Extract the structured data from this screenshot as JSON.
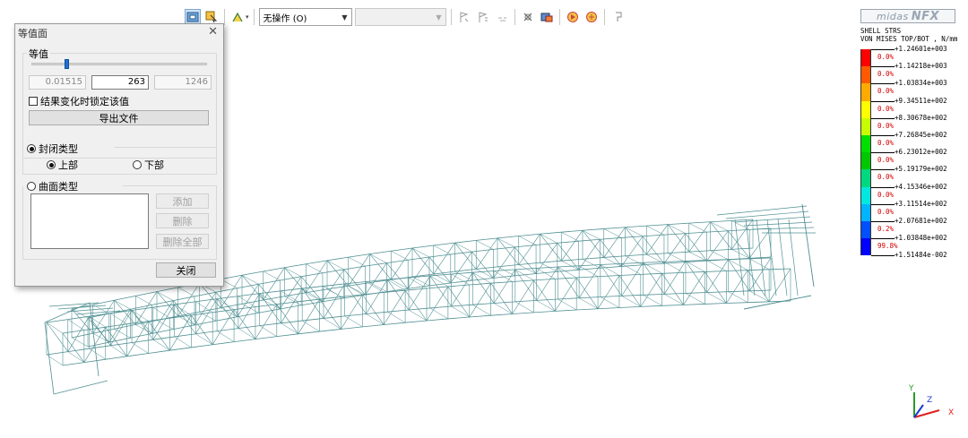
{
  "toolbar": {
    "operation_select": "无操作 (O)",
    "secondary_select": ""
  },
  "dialog": {
    "title": "等值面",
    "iso_group_title": "等值",
    "slider_value": 0.2,
    "min_value": "0.01515",
    "current_value": "263",
    "max_value": "1246",
    "lock_label": "结果变化时锁定该值",
    "export_button": "导出文件",
    "closed_type_label": "封闭类型",
    "upper_label": "上部",
    "lower_label": "下部",
    "surface_type_label": "曲面类型",
    "add_button": "添加",
    "delete_button": "删除",
    "delete_all_button": "删除全部",
    "close_button": "关闭"
  },
  "legend": {
    "logo": "midas",
    "logo_bold": "NFX",
    "title_line1": "SHELL STRS",
    "title_line2": "VON MISES TOP/BOT , N/mm",
    "values": [
      "+1.24601e+003",
      "+1.14218e+003",
      "+1.03834e+003",
      "+9.34511e+002",
      "+8.30678e+002",
      "+7.26845e+002",
      "+6.23012e+002",
      "+5.19179e+002",
      "+4.15346e+002",
      "+3.11514e+002",
      "+2.07681e+002",
      "+1.03848e+002",
      "+1.51484e-002"
    ],
    "percents": [
      "0.0%",
      "0.0%",
      "0.0%",
      "0.0%",
      "0.0%",
      "0.0%",
      "0.0%",
      "0.0%",
      "0.0%",
      "0.0%",
      "0.2%",
      "99.8%"
    ],
    "colors": [
      "#ff0000",
      "#ff5a00",
      "#ffaa00",
      "#ffff00",
      "#c8ff00",
      "#00e000",
      "#00c800",
      "#00d880",
      "#00e8e0",
      "#00b4ff",
      "#0050ff",
      "#0000ff"
    ]
  },
  "axis": {
    "y": "Y",
    "z": "Z",
    "x": "X"
  }
}
